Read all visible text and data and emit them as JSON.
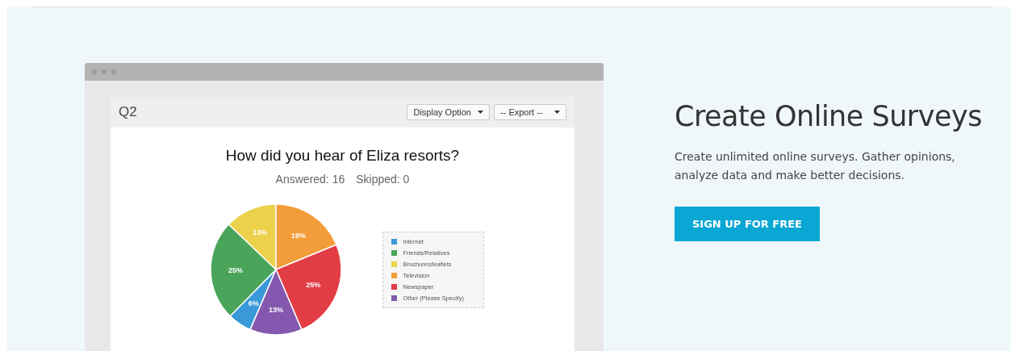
{
  "preview": {
    "question_number": "Q2",
    "controls": [
      {
        "label": "Display Option"
      },
      {
        "label": "-- Export --"
      }
    ],
    "question": "How did you hear of Eliza resorts?",
    "answered": "Answered: 16",
    "skipped": "Skipped: 0",
    "chart_data": {
      "type": "pie",
      "categories": [
        "Internet",
        "Friends/Relatives",
        "Brochures/leaflets",
        "Television",
        "Newspaper",
        "Other (Please Specify)"
      ],
      "series": [
        {
          "values": [
            6,
            25,
            13,
            19,
            25,
            13
          ]
        }
      ],
      "value_labels": [
        "6%",
        "25%",
        "13%",
        "19%",
        "25%",
        "13%"
      ],
      "colors": [
        "#3a9ad9",
        "#4aa55a",
        "#ecd14a",
        "#f39c3a",
        "#e23c44",
        "#8458ae"
      ]
    }
  },
  "hero": {
    "title": "Create Online Surveys",
    "description": "Create unlimited online surveys. Gather opinions, analyze data and make better decisions.",
    "cta": "SIGN UP FOR FREE"
  }
}
